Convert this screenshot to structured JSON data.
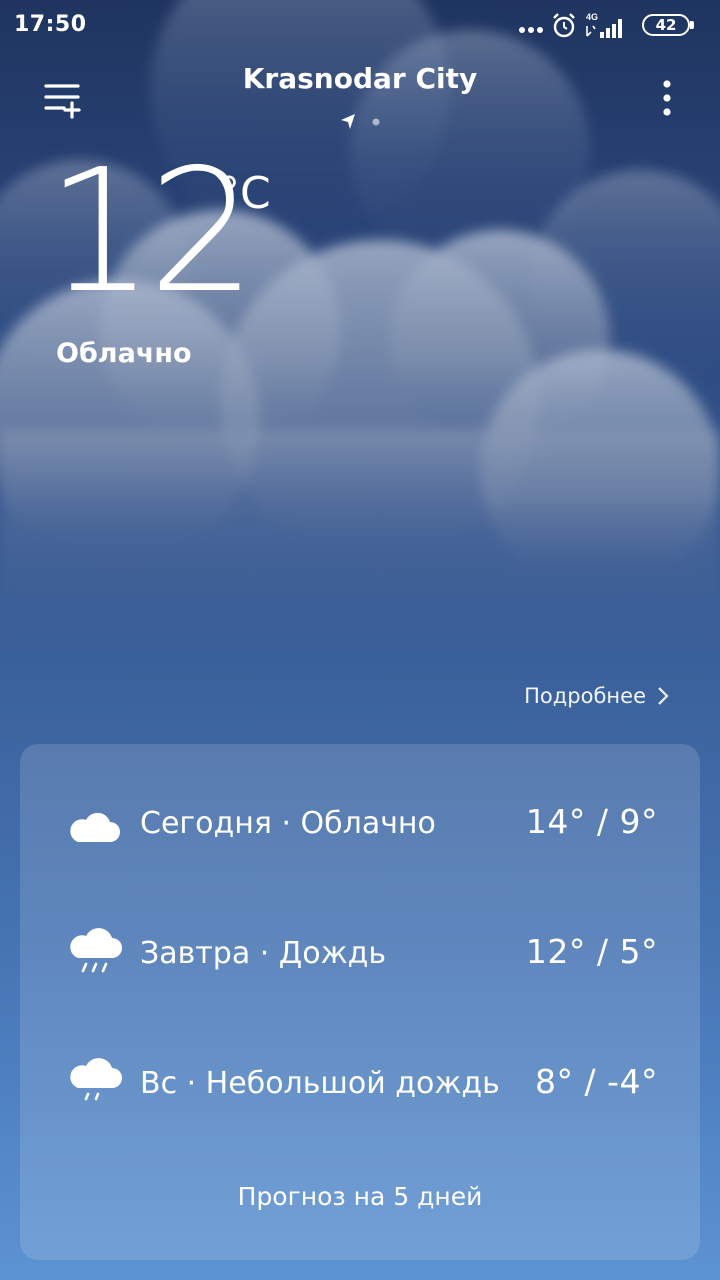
{
  "status_bar": {
    "time": "17:50",
    "network": "4G",
    "battery": "42"
  },
  "header": {
    "city": "Krasnodar City",
    "menu_icon": "add-city-list-icon",
    "more_icon": "more-vertical-icon"
  },
  "current": {
    "temperature": "12",
    "unit": "°C",
    "condition": "Облачно"
  },
  "details_link": "Подробнее",
  "forecast": [
    {
      "label": "Сегодня · Облачно",
      "temps": "14° / 9°",
      "icon": "partly-cloudy-night-icon"
    },
    {
      "label": "Завтра · Дождь",
      "temps": "12° / 5°",
      "icon": "rain-cloud-icon"
    },
    {
      "label": "Вс · Небольшой дождь",
      "temps": "8° / -4°",
      "icon": "light-rain-cloud-icon"
    }
  ],
  "forecast_footer": "Прогноз на 5 дней",
  "colors": {
    "sky_top": "#1f3560",
    "sky_bottom": "#5c93d2",
    "moon": "#f3d23a"
  }
}
